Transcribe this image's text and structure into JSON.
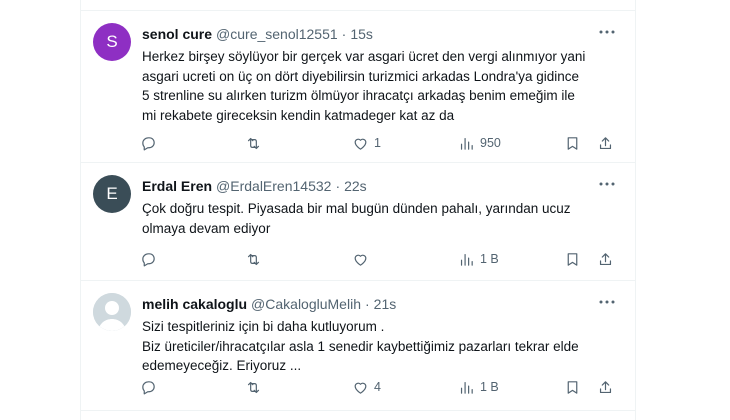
{
  "tweets": [
    {
      "avatar_letter": "S",
      "avatar_color": "#8e2fc3",
      "name": "senol cure",
      "handle": "@cure_senol12551",
      "separator": "·",
      "time": "15s",
      "lines": [
        "Herkez birşey söylüyor bir gerçek var  asgari ücret den vergi alınmıyor yani",
        "asgari ucreti on üç on dört diyebilirsin turizmici arkadas  Londra'ya gidince",
        "5 strenline su alırken turizm ölmüyor ihracatçı arkadaş benim emeğim ile",
        "mi rekabete gireceksin kendin katmadeger kat az da"
      ],
      "replies": "",
      "retweets": "",
      "likes": "1",
      "views": "950"
    },
    {
      "avatar_letter": "E",
      "avatar_color": "#3a4d57",
      "name": "Erdal Eren",
      "handle": "@ErdalEren14532",
      "separator": "·",
      "time": "22s",
      "lines": [
        "Çok doğru tespit. Piyasada bir mal bugün dünden pahalı, yarından ucuz",
        "olmaya devam ediyor"
      ],
      "replies": "",
      "retweets": "",
      "likes": "",
      "views": "1 B"
    },
    {
      "avatar_letter": "",
      "avatar_color": "#cfd9de",
      "name": "melih cakaloglu",
      "handle": "@CakalogluMelih",
      "separator": "·",
      "time": "21s",
      "lines": [
        "Sizi tespitleriniz için bi daha kutluyorum .",
        "Biz üreticiler/ihracatçılar  asla 1 senedir kaybettiğimiz pazarları tekrar elde",
        "edemeyeceğiz.  Eriyoruz ..."
      ],
      "replies": "",
      "retweets": "",
      "likes": "4",
      "views": "1 B"
    }
  ],
  "icons": {
    "reply": "reply-icon",
    "retweet": "retweet-icon",
    "like": "heart-icon",
    "views": "views-chart-icon",
    "bookmark": "bookmark-icon",
    "share": "share-icon",
    "more": "more-dots-icon"
  }
}
